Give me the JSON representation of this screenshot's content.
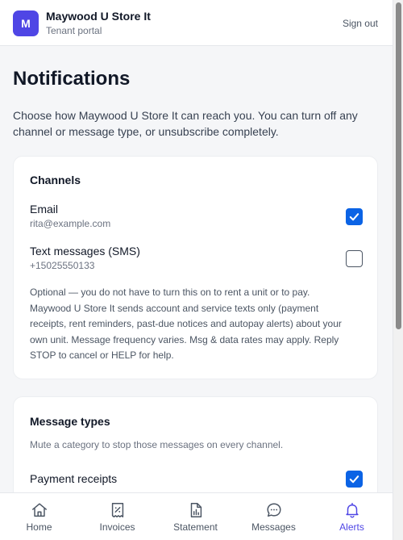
{
  "header": {
    "logo_letter": "M",
    "store_name": "Maywood U Store It",
    "subtitle": "Tenant portal",
    "sign_out": "Sign out"
  },
  "page": {
    "title": "Notifications",
    "intro": "Choose how Maywood U Store It can reach you. You can turn off any channel or message type, or unsubscribe completely."
  },
  "channels": {
    "title": "Channels",
    "email": {
      "label": "Email",
      "value": "rita@example.com",
      "checked": true
    },
    "sms": {
      "label": "Text messages (SMS)",
      "value": "+15025550133",
      "checked": false
    },
    "sms_note": "Optional — you do not have to turn this on to rent a unit or to pay. Maywood U Store It sends account and service texts only (payment receipts, rent reminders, past-due notices and autopay alerts) about your own unit. Message frequency varies. Msg & data rates may apply. Reply STOP to cancel or HELP for help."
  },
  "message_types": {
    "title": "Message types",
    "description": "Mute a category to stop those messages on every channel.",
    "items": [
      {
        "label": "Payment receipts",
        "checked": true
      }
    ]
  },
  "nav": {
    "items": [
      {
        "label": "Home",
        "icon": "home-icon"
      },
      {
        "label": "Invoices",
        "icon": "invoice-icon"
      },
      {
        "label": "Statement",
        "icon": "statement-icon"
      },
      {
        "label": "Messages",
        "icon": "chat-icon"
      },
      {
        "label": "Alerts",
        "icon": "bell-icon",
        "active": true
      }
    ]
  },
  "colors": {
    "brand": "#4f46e5",
    "checkbox_on": "#0b63e5"
  }
}
